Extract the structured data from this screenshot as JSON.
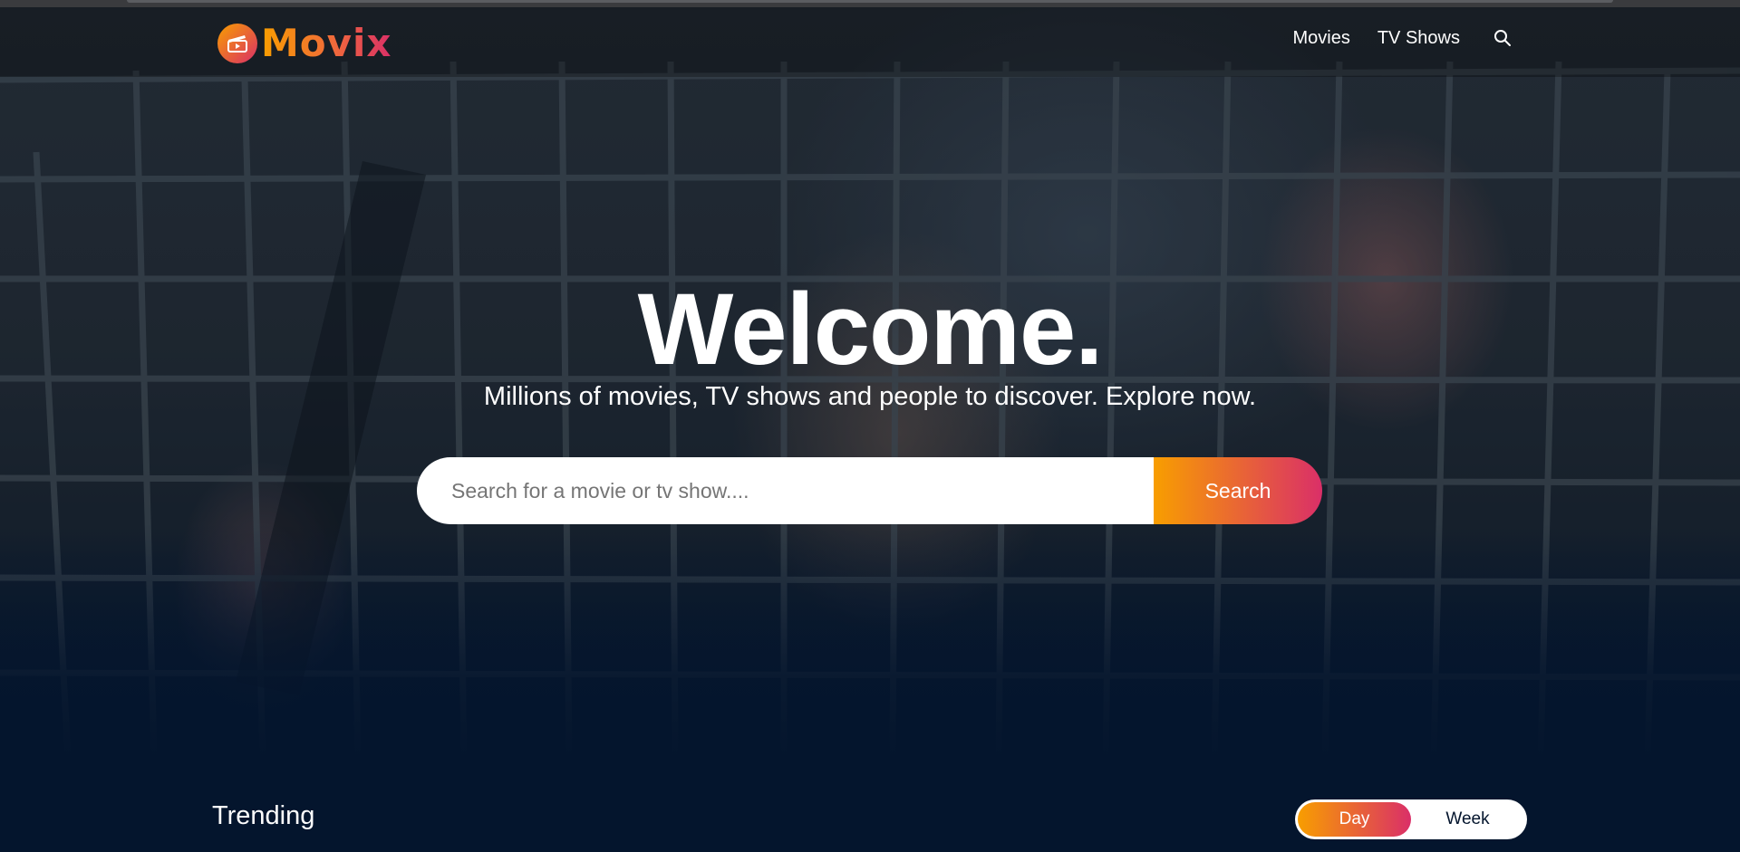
{
  "brand": {
    "name": "Movix"
  },
  "nav": {
    "items": [
      "Movies",
      "TV Shows"
    ]
  },
  "hero": {
    "title": "Welcome.",
    "subtitle": "Millions of movies, TV shows and people to discover. Explore now.",
    "search_placeholder": "Search for a movie or tv show....",
    "search_button": "Search"
  },
  "trending": {
    "title": "Trending",
    "tabs": [
      "Day",
      "Week"
    ],
    "active_tab": "Day"
  },
  "colors": {
    "accent_start": "#f89e00",
    "accent_end": "#da2f68",
    "background": "#04152d"
  }
}
